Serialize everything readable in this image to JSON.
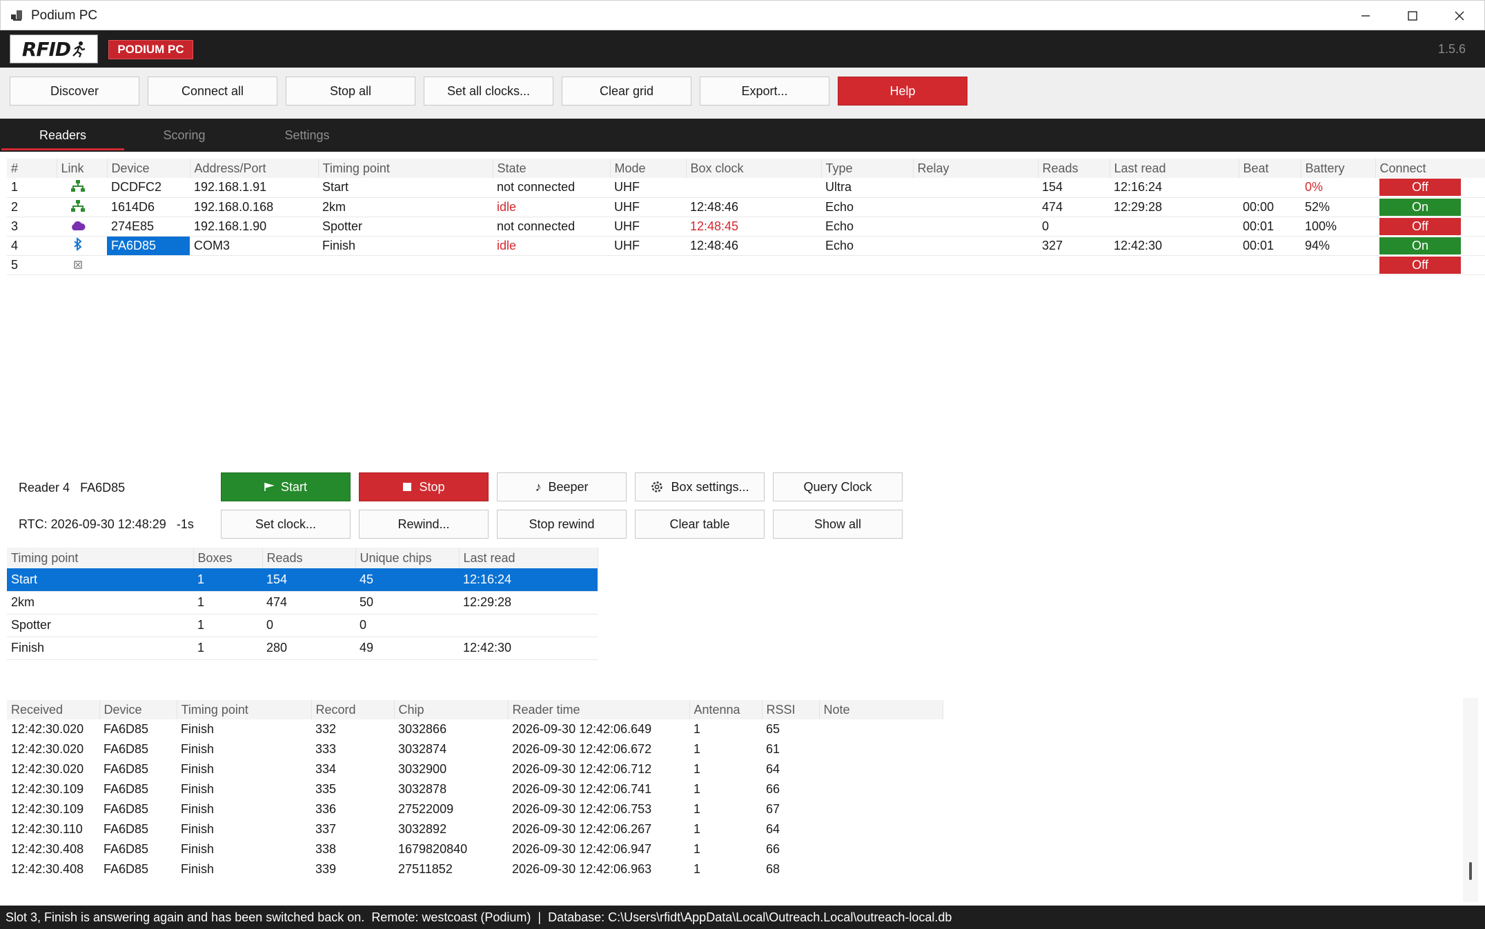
{
  "window": {
    "title": "Podium PC"
  },
  "brand": {
    "logo_text": "RFID",
    "product": "PODIUM PC",
    "version": "1.5.6",
    "accent": "#d2292f"
  },
  "toolbar": {
    "discover": "Discover",
    "connect_all": "Connect all",
    "stop_all": "Stop all",
    "set_all_clocks": "Set all clocks...",
    "clear_grid": "Clear grid",
    "export": "Export...",
    "help": "Help"
  },
  "tabs": [
    {
      "label": "Readers",
      "active": true
    },
    {
      "label": "Scoring",
      "active": false
    },
    {
      "label": "Settings",
      "active": false
    }
  ],
  "readers": {
    "headers": [
      "#",
      "Link",
      "Device",
      "Address/Port",
      "Timing point",
      "State",
      "Mode",
      "Box clock",
      "Type",
      "Relay",
      "Reads",
      "Last read",
      "Beat",
      "Battery",
      "Connect"
    ],
    "rows": [
      {
        "num": "1",
        "link": "network-icon",
        "device": "DCDFC2",
        "address": "192.168.1.91",
        "timing_point": "Start",
        "state": "not connected",
        "mode": "UHF",
        "box_clock": "",
        "type": "Ultra",
        "relay": "",
        "reads": "154",
        "last_read": "12:16:24",
        "beat": "",
        "battery": "0%",
        "connect": "Off"
      },
      {
        "num": "2",
        "link": "network-icon",
        "device": "1614D6",
        "address": "192.168.0.168",
        "timing_point": "2km",
        "state": "idle",
        "mode": "UHF",
        "box_clock": "12:48:46",
        "type": "Echo",
        "relay": "",
        "reads": "474",
        "last_read": "12:29:28",
        "beat": "00:00",
        "battery": "52%",
        "connect": "On"
      },
      {
        "num": "3",
        "link": "cloud-icon",
        "device": "274E85",
        "address": "192.168.1.90",
        "timing_point": "Spotter",
        "state": "not connected",
        "mode": "UHF",
        "box_clock": "12:48:45",
        "type": "Echo",
        "relay": "",
        "reads": "0",
        "last_read": "",
        "beat": "00:01",
        "battery": "100%",
        "connect": "Off"
      },
      {
        "num": "4",
        "link": "bluetooth-icon",
        "device": "FA6D85",
        "address": "COM3",
        "timing_point": "Finish",
        "state": "idle",
        "mode": "UHF",
        "box_clock": "12:48:46",
        "type": "Echo",
        "relay": "",
        "reads": "327",
        "last_read": "12:42:30",
        "beat": "00:01",
        "battery": "94%",
        "connect": "On"
      },
      {
        "num": "5",
        "link": "empty-slot-icon",
        "device": "",
        "address": "",
        "timing_point": "",
        "state": "",
        "mode": "",
        "box_clock": "",
        "type": "",
        "relay": "",
        "reads": "",
        "last_read": "",
        "beat": "",
        "battery": "",
        "connect": "Off"
      }
    ]
  },
  "reader_detail": {
    "reader_label": "Reader 4",
    "device": "FA6D85",
    "rtc": "RTC: 2026-09-30 12:48:29",
    "offset": "-1s",
    "buttons": {
      "start": "Start",
      "stop": "Stop",
      "beeper": "Beeper",
      "box_settings": "Box settings...",
      "query_clock": "Query Clock",
      "set_clock": "Set clock...",
      "rewind": "Rewind...",
      "stop_rewind": "Stop rewind",
      "clear_table": "Clear table",
      "show_all": "Show all"
    }
  },
  "timing_points": {
    "headers": [
      "Timing point",
      "Boxes",
      "Reads",
      "Unique chips",
      "Last read"
    ],
    "rows": [
      [
        "Start",
        "1",
        "154",
        "45",
        "12:16:24"
      ],
      [
        "2km",
        "1",
        "474",
        "50",
        "12:29:28"
      ],
      [
        "Spotter",
        "1",
        "0",
        "0",
        ""
      ],
      [
        "Finish",
        "1",
        "280",
        "49",
        "12:42:30"
      ]
    ]
  },
  "reads": {
    "headers": [
      "Received",
      "Device",
      "Timing point",
      "Record",
      "Chip",
      "Reader time",
      "Antenna",
      "RSSI",
      "Note"
    ],
    "rows": [
      [
        "12:42:30.020",
        "FA6D85",
        "Finish",
        "332",
        "3032866",
        "2026-09-30 12:42:06.649",
        "1",
        "65",
        ""
      ],
      [
        "12:42:30.020",
        "FA6D85",
        "Finish",
        "333",
        "3032874",
        "2026-09-30 12:42:06.672",
        "1",
        "61",
        ""
      ],
      [
        "12:42:30.020",
        "FA6D85",
        "Finish",
        "334",
        "3032900",
        "2026-09-30 12:42:06.712",
        "1",
        "64",
        ""
      ],
      [
        "12:42:30.109",
        "FA6D85",
        "Finish",
        "335",
        "3032878",
        "2026-09-30 12:42:06.741",
        "1",
        "66",
        ""
      ],
      [
        "12:42:30.109",
        "FA6D85",
        "Finish",
        "336",
        "27522009",
        "2026-09-30 12:42:06.753",
        "1",
        "67",
        ""
      ],
      [
        "12:42:30.110",
        "FA6D85",
        "Finish",
        "337",
        "3032892",
        "2026-09-30 12:42:06.267",
        "1",
        "64",
        ""
      ],
      [
        "12:42:30.408",
        "FA6D85",
        "Finish",
        "338",
        "1679820840",
        "2026-09-30 12:42:06.947",
        "1",
        "66",
        ""
      ],
      [
        "12:42:30.408",
        "FA6D85",
        "Finish",
        "339",
        "27511852",
        "2026-09-30 12:42:06.963",
        "1",
        "68",
        ""
      ]
    ]
  },
  "status": {
    "message": "Slot 3, Finish is answering again and has been switched back on.",
    "remote": "Remote: westcoast (Podium)",
    "separator": "|",
    "database": "Database: C:\\Users\\rfidt\\AppData\\Local\\Outreach.Local\\outreach-local.db"
  }
}
